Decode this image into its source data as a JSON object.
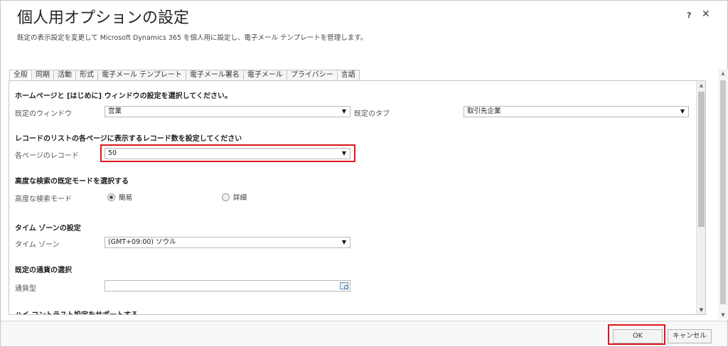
{
  "header": {
    "title": "個人用オプションの設定",
    "subtitle": "既定の表示設定を変更して Microsoft Dynamics 365 を個人用に設定し、電子メール テンプレートを管理します。",
    "help_glyph": "?",
    "close_glyph": "✕"
  },
  "tabs": [
    {
      "label": "全般"
    },
    {
      "label": "同期"
    },
    {
      "label": "活動"
    },
    {
      "label": "形式"
    },
    {
      "label": "電子メール テンプレート"
    },
    {
      "label": "電子メール署名"
    },
    {
      "label": "電子メール"
    },
    {
      "label": "プライバシー"
    },
    {
      "label": "言語"
    }
  ],
  "sections": {
    "homepage": {
      "title": "ホームページと [はじめに] ウィンドウの設定を選択してください。",
      "default_window_label": "既定のウィンドウ",
      "default_window_value": "営業",
      "default_tab_label": "既定のタブ",
      "default_tab_value": "取引先企業"
    },
    "records": {
      "title": "レコードのリストの各ページに表示するレコード数を設定してください",
      "per_page_label": "各ページのレコード",
      "per_page_value": "50"
    },
    "advanced_find": {
      "title": "高度な検索の既定モードを選択する",
      "mode_label": "高度な検索モード",
      "simple_label": "簡易",
      "detailed_label": "詳細",
      "selected": "simple"
    },
    "timezone": {
      "title": "タイム ゾーンの設定",
      "label": "タイム ゾーン",
      "value": "(GMT+09:00) ソウル"
    },
    "currency": {
      "title": "既定の通貨の選択",
      "label": "通貨型",
      "value": ""
    },
    "high_contrast": {
      "title": "ハイ コントラスト設定をサポートする"
    }
  },
  "dropdown_arrow": "▼",
  "scroll_up": "▲",
  "scroll_down": "▼",
  "buttons": {
    "ok": "OK",
    "cancel": "キャンセル"
  },
  "colors": {
    "highlight": "#e0161e"
  }
}
